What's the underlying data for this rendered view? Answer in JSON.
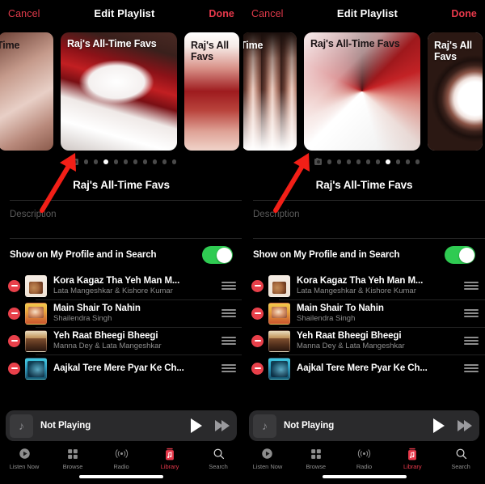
{
  "nav": {
    "cancel_label": "Cancel",
    "title": "Edit Playlist",
    "done_label": "Done"
  },
  "artwork": {
    "label": "Raj's All-Time Favs",
    "label_left_partial": "-Time",
    "label_right_partial": "Raj's All Favs",
    "camera_icon": "camera-icon"
  },
  "playlist": {
    "title": "Raj's All-Time Favs",
    "description_placeholder": "Description",
    "show_on_profile_label": "Show on My Profile and in Search",
    "show_on_profile_on": true
  },
  "songs": [
    {
      "title": "Kora Kagaz Tha Yeh Man M...",
      "artist": "Lata Mangeshkar & Kishore Kumar"
    },
    {
      "title": "Main Shair To Nahin",
      "artist": "Shailendra Singh"
    },
    {
      "title": "Yeh Raat Bheegi Bheegi",
      "artist": "Manna Dey & Lata Mangeshkar"
    },
    {
      "title": "Aajkal Tere Mere Pyar Ke Ch...",
      "artist": ""
    }
  ],
  "miniplayer": {
    "title": "Not Playing",
    "artwork_icon": "music-note-icon",
    "play_icon": "play-icon",
    "forward_icon": "fast-forward-icon"
  },
  "tabbar": [
    {
      "label": "Listen Now",
      "icon": "play-circle-icon",
      "active": false
    },
    {
      "label": "Browse",
      "icon": "grid-icon",
      "active": false
    },
    {
      "label": "Radio",
      "icon": "broadcast-icon",
      "active": false
    },
    {
      "label": "Library",
      "icon": "library-icon",
      "active": true
    },
    {
      "label": "Search",
      "icon": "search-icon",
      "active": false
    }
  ],
  "pagination": {
    "left_panel_total_dots": 10,
    "left_panel_active_index": 2,
    "right_panel_total_dots": 10,
    "right_panel_active_index": 6
  },
  "colors": {
    "accent_red": "#e8394b",
    "toggle_green": "#2fcb52",
    "annotation_arrow": "#f21f17",
    "background": "#000000"
  },
  "annotations": [
    {
      "name": "arrow-left-panel",
      "points_to": "playlist-artwork-bottom-left"
    },
    {
      "name": "arrow-right-panel",
      "points_to": "playlist-artwork-bottom-left"
    }
  ]
}
